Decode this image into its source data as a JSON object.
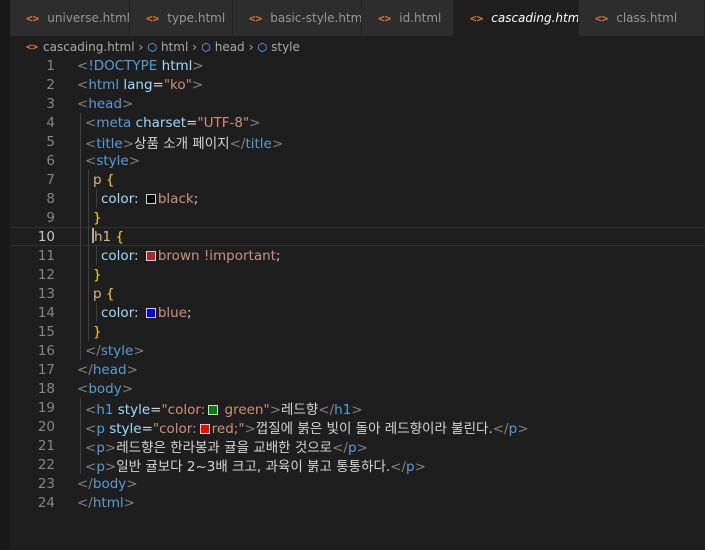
{
  "tabs": [
    {
      "label": "universe.html",
      "active": false,
      "width": 120
    },
    {
      "label": "type.html",
      "active": false,
      "width": 103
    },
    {
      "label": "basic-style.html",
      "active": false,
      "width": 129
    },
    {
      "label": "id.html",
      "active": false,
      "width": 92
    },
    {
      "label": "cascading.html",
      "active": true,
      "width": 125
    },
    {
      "label": "class.html",
      "active": false,
      "width": 126
    }
  ],
  "tab_close_glyph": "×",
  "file_icon_glyph": "<>",
  "breadcrumb": {
    "file": "cascading.html",
    "items": [
      "html",
      "head",
      "style"
    ],
    "separator": "›"
  },
  "current_line": 10,
  "lines": [
    {
      "n": 1,
      "indent": 0,
      "tokens": [
        [
          "punc",
          "<"
        ],
        [
          "tag",
          "!DOCTYPE "
        ],
        [
          "attr",
          "html"
        ],
        [
          "punc",
          ">"
        ]
      ]
    },
    {
      "n": 2,
      "indent": 0,
      "tokens": [
        [
          "punc",
          "<"
        ],
        [
          "tag",
          "html "
        ],
        [
          "attr",
          "lang"
        ],
        [
          "text",
          "="
        ],
        [
          "str",
          "\"ko\""
        ],
        [
          "punc",
          ">"
        ]
      ]
    },
    {
      "n": 3,
      "indent": 0,
      "tokens": [
        [
          "punc",
          "<"
        ],
        [
          "tag",
          "head"
        ],
        [
          "punc",
          ">"
        ]
      ]
    },
    {
      "n": 4,
      "indent": 1,
      "tokens": [
        [
          "punc",
          "<"
        ],
        [
          "tag",
          "meta "
        ],
        [
          "attr",
          "charset"
        ],
        [
          "text",
          "="
        ],
        [
          "str",
          "\"UTF-8\""
        ],
        [
          "punc",
          ">"
        ]
      ]
    },
    {
      "n": 5,
      "indent": 1,
      "tokens": [
        [
          "punc",
          "<"
        ],
        [
          "tag",
          "title"
        ],
        [
          "punc",
          ">"
        ],
        [
          "text",
          "상품 소개 페이지"
        ],
        [
          "punc",
          "</"
        ],
        [
          "tag",
          "title"
        ],
        [
          "punc",
          ">"
        ]
      ]
    },
    {
      "n": 6,
      "indent": 1,
      "tokens": [
        [
          "punc",
          "<"
        ],
        [
          "tag",
          "style"
        ],
        [
          "punc",
          ">"
        ]
      ]
    },
    {
      "n": 7,
      "indent": 2,
      "tokens": [
        [
          "sel",
          "p "
        ],
        [
          "brace",
          "{"
        ]
      ]
    },
    {
      "n": 8,
      "indent": 3,
      "tokens": [
        [
          "prop",
          "color"
        ],
        [
          "text",
          ": "
        ],
        [
          "swatch",
          "#000000"
        ],
        [
          "val",
          "black"
        ],
        [
          "text",
          ";"
        ]
      ]
    },
    {
      "n": 9,
      "indent": 2,
      "tokens": [
        [
          "brace",
          "}"
        ]
      ]
    },
    {
      "n": 10,
      "indent": 2,
      "tokens": [
        [
          "cursor",
          ""
        ],
        [
          "sel",
          "h1 "
        ],
        [
          "brace",
          "{"
        ]
      ]
    },
    {
      "n": 11,
      "indent": 3,
      "tokens": [
        [
          "prop",
          "color"
        ],
        [
          "text",
          ": "
        ],
        [
          "swatch",
          "#a52a2a"
        ],
        [
          "val",
          "brown !important"
        ],
        [
          "text",
          ";"
        ]
      ]
    },
    {
      "n": 12,
      "indent": 2,
      "tokens": [
        [
          "brace",
          "}"
        ]
      ]
    },
    {
      "n": 13,
      "indent": 2,
      "tokens": [
        [
          "sel",
          "p "
        ],
        [
          "brace",
          "{"
        ]
      ]
    },
    {
      "n": 14,
      "indent": 3,
      "tokens": [
        [
          "prop",
          "color"
        ],
        [
          "text",
          ": "
        ],
        [
          "swatch",
          "#0000ff"
        ],
        [
          "val",
          "blue"
        ],
        [
          "text",
          ";"
        ]
      ]
    },
    {
      "n": 15,
      "indent": 2,
      "tokens": [
        [
          "brace",
          "}"
        ]
      ]
    },
    {
      "n": 16,
      "indent": 1,
      "tokens": [
        [
          "punc",
          "</"
        ],
        [
          "tag",
          "style"
        ],
        [
          "punc",
          ">"
        ]
      ]
    },
    {
      "n": 17,
      "indent": 0,
      "tokens": [
        [
          "punc",
          "</"
        ],
        [
          "tag",
          "head"
        ],
        [
          "punc",
          ">"
        ]
      ]
    },
    {
      "n": 18,
      "indent": 0,
      "tokens": [
        [
          "punc",
          "<"
        ],
        [
          "tag",
          "body"
        ],
        [
          "punc",
          ">"
        ]
      ]
    },
    {
      "n": 19,
      "indent": 1,
      "tokens": [
        [
          "punc",
          "<"
        ],
        [
          "tag",
          "h1 "
        ],
        [
          "attr",
          "style"
        ],
        [
          "text",
          "="
        ],
        [
          "str",
          "\"color:"
        ],
        [
          "swatch",
          "#008000"
        ],
        [
          "str",
          " green\""
        ],
        [
          "punc",
          ">"
        ],
        [
          "text",
          "레드향"
        ],
        [
          "punc",
          "</"
        ],
        [
          "tag",
          "h1"
        ],
        [
          "punc",
          ">"
        ]
      ]
    },
    {
      "n": 20,
      "indent": 1,
      "tokens": [
        [
          "punc",
          "<"
        ],
        [
          "tag",
          "p "
        ],
        [
          "attr",
          "style"
        ],
        [
          "text",
          "="
        ],
        [
          "str",
          "\"color:"
        ],
        [
          "swatch",
          "#ff0000"
        ],
        [
          "str",
          "red;\""
        ],
        [
          "punc",
          ">"
        ],
        [
          "text",
          "껍질에 붉은 빛이 돌아 레드향이라 불린다."
        ],
        [
          "punc",
          "</"
        ],
        [
          "tag",
          "p"
        ],
        [
          "punc",
          ">"
        ]
      ]
    },
    {
      "n": 21,
      "indent": 1,
      "tokens": [
        [
          "punc",
          "<"
        ],
        [
          "tag",
          "p"
        ],
        [
          "punc",
          ">"
        ],
        [
          "text",
          "레드향은 한라봉과 귤을 교배한 것으로"
        ],
        [
          "punc",
          "</"
        ],
        [
          "tag",
          "p"
        ],
        [
          "punc",
          ">"
        ]
      ]
    },
    {
      "n": 22,
      "indent": 1,
      "tokens": [
        [
          "punc",
          "<"
        ],
        [
          "tag",
          "p"
        ],
        [
          "punc",
          ">"
        ],
        [
          "text",
          "일반 귤보다 2~3배 크고, 과육이 붉고 통통하다."
        ],
        [
          "punc",
          "</"
        ],
        [
          "tag",
          "p"
        ],
        [
          "punc",
          ">"
        ]
      ]
    },
    {
      "n": 23,
      "indent": 0,
      "tokens": [
        [
          "punc",
          "</"
        ],
        [
          "tag",
          "body"
        ],
        [
          "punc",
          ">"
        ]
      ]
    },
    {
      "n": 24,
      "indent": 0,
      "tokens": [
        [
          "punc",
          "</"
        ],
        [
          "tag",
          "html"
        ],
        [
          "punc",
          ">"
        ]
      ]
    }
  ]
}
